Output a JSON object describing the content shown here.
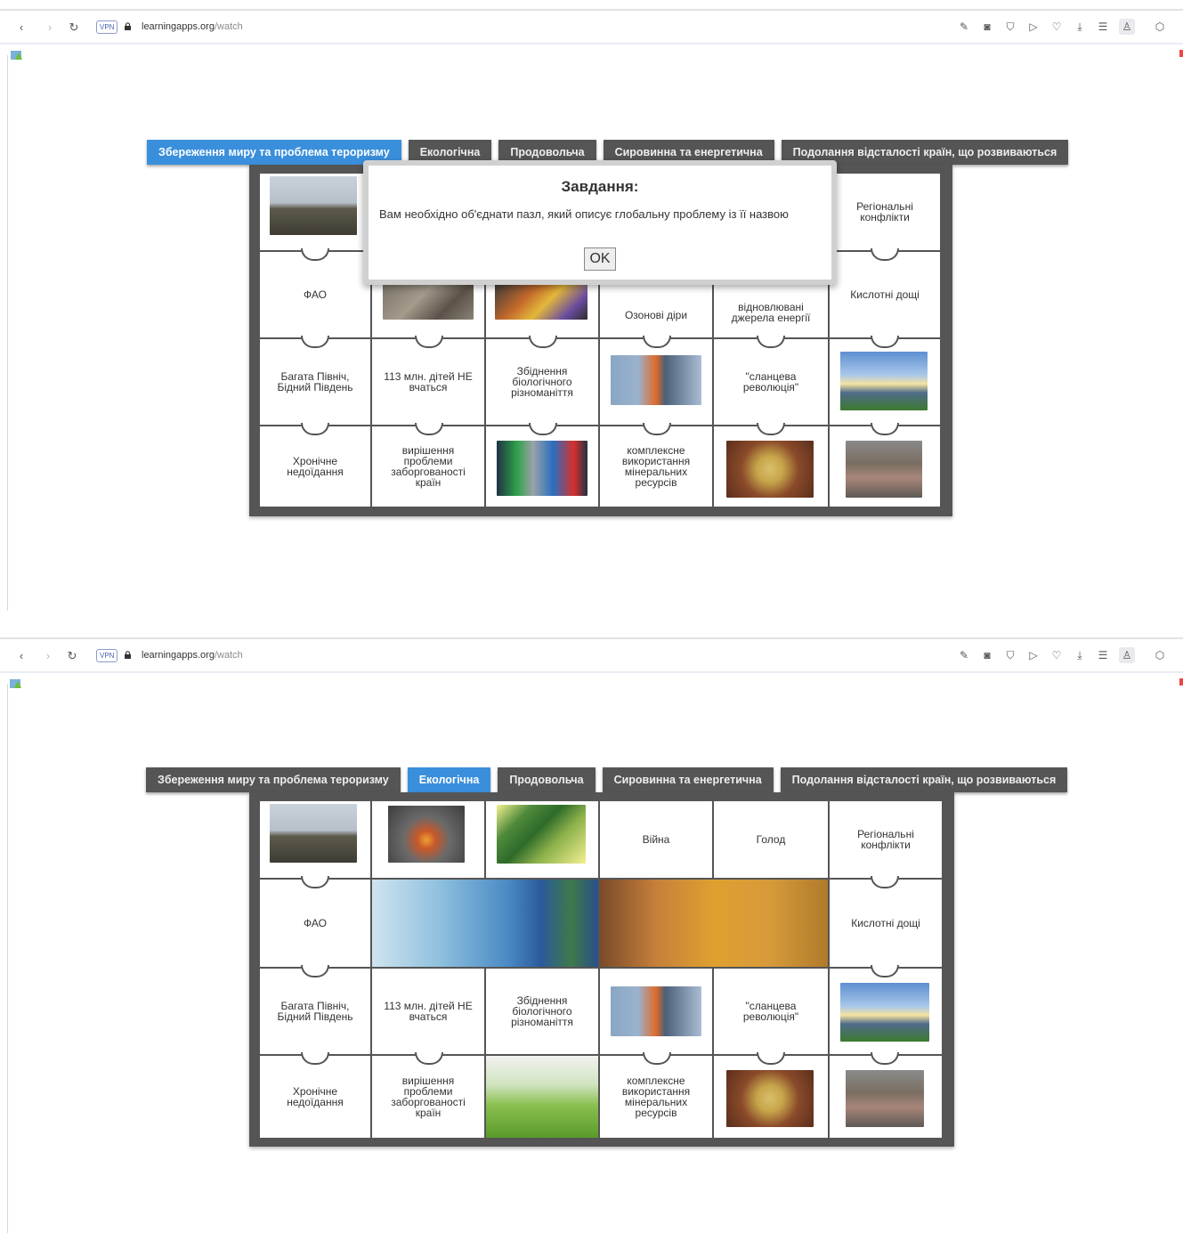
{
  "browser": {
    "url_host": "learningapps.org",
    "url_path": "/watch",
    "vpn_label": "VPN"
  },
  "tabs": [
    "Збереження миру та проблема тероризму",
    "Екологічна",
    "Продовольча",
    "Сировинна та енергетична",
    "Подолання відсталості країн, що розвиваються"
  ],
  "dialog": {
    "title": "Завдання:",
    "text": "Вам необхідно об'єднати пазл, який описує глобальну проблему із її назвою",
    "ok_label": "OK"
  },
  "shot1": {
    "active_tab": 0,
    "pieces": {
      "r0c5": "Регіональні конфлікти",
      "r1c0": "ФАО",
      "r1c3": "Озонові діри",
      "r1c4": "відновлювані джерела енергії",
      "r1c5": "Кислотні дощі",
      "r2c0": "Багата Північ, Бідний Південь",
      "r2c1": "113 млн. дітей НЕ вчаться",
      "r2c2": "Збіднення біологічного різноманіття",
      "r2c4": "\"сланцева революція\"",
      "r3c0": "Хронічне недоїдання",
      "r3c1": "вирішення проблеми заборгованості країн",
      "r3c3": "комплексне використання мінеральних ресурсів"
    }
  },
  "shot2": {
    "active_tab": 1,
    "pieces": {
      "r0c3": "Війна",
      "r0c4": "Голод",
      "r0c5": "Регіональні конфлікти",
      "r1c0": "ФАО",
      "r1c5": "Кислотні дощі",
      "r2c0": "Багата Північ, Бідний Південь",
      "r2c1": "113 млн. дітей НЕ вчаться",
      "r2c2": "Збіднення біологічного різноманіття",
      "r2c4": "\"сланцева революція\"",
      "r3c0": "Хронічне недоїдання",
      "r3c1": "вирішення проблеми заборгованості країн",
      "r3c3": "комплексне використання мінеральних ресурсів"
    }
  },
  "colors": {
    "active_tab": "#3a8fdc",
    "tab": "#555555",
    "board": "#555555"
  }
}
